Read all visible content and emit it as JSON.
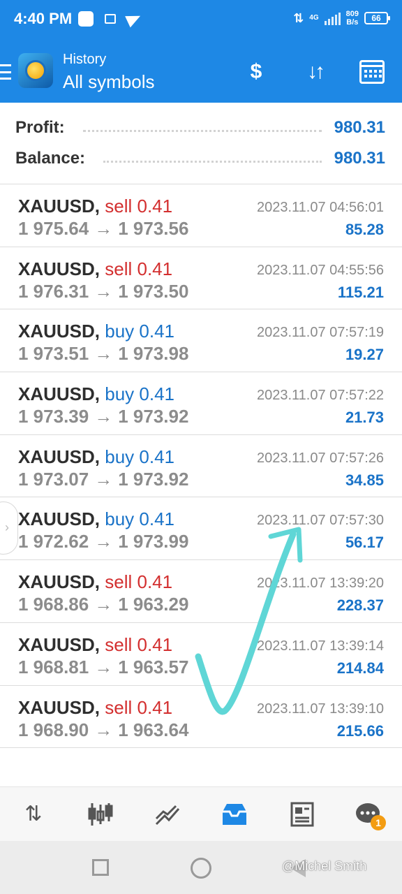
{
  "status": {
    "time": "4:40 PM",
    "network": "4G",
    "speed_value": "809",
    "speed_unit": "B/s",
    "battery": "66"
  },
  "header": {
    "subtitle": "History",
    "title": "All symbols",
    "icons": [
      "currency-exchange-icon",
      "sort-icon",
      "calendar-icon"
    ]
  },
  "summary": {
    "profit_label": "Profit:",
    "profit_value": "980.31",
    "balance_label": "Balance:",
    "balance_value": "980.31"
  },
  "deals": [
    {
      "symbol": "XAUUSD,",
      "direction": "sell",
      "volume": "0.41",
      "open": "1 975.64",
      "close": "1 973.56",
      "time": "2023.11.07 04:56:01",
      "profit": "85.28"
    },
    {
      "symbol": "XAUUSD,",
      "direction": "sell",
      "volume": "0.41",
      "open": "1 976.31",
      "close": "1 973.50",
      "time": "2023.11.07 04:55:56",
      "profit": "115.21"
    },
    {
      "symbol": "XAUUSD,",
      "direction": "buy",
      "volume": "0.41",
      "open": "1 973.51",
      "close": "1 973.98",
      "time": "2023.11.07 07:57:19",
      "profit": "19.27"
    },
    {
      "symbol": "XAUUSD,",
      "direction": "buy",
      "volume": "0.41",
      "open": "1 973.39",
      "close": "1 973.92",
      "time": "2023.11.07 07:57:22",
      "profit": "21.73"
    },
    {
      "symbol": "XAUUSD,",
      "direction": "buy",
      "volume": "0.41",
      "open": "1 973.07",
      "close": "1 973.92",
      "time": "2023.11.07 07:57:26",
      "profit": "34.85"
    },
    {
      "symbol": "XAUUSD,",
      "direction": "buy",
      "volume": "0.41",
      "open": "1 972.62",
      "close": "1 973.99",
      "time": "2023.11.07 07:57:30",
      "profit": "56.17"
    },
    {
      "symbol": "XAUUSD,",
      "direction": "sell",
      "volume": "0.41",
      "open": "1 968.86",
      "close": "1 963.29",
      "time": "2023.11.07 13:39:20",
      "profit": "228.37"
    },
    {
      "symbol": "XAUUSD,",
      "direction": "sell",
      "volume": "0.41",
      "open": "1 968.81",
      "close": "1 963.57",
      "time": "2023.11.07 13:39:14",
      "profit": "214.84"
    },
    {
      "symbol": "XAUUSD,",
      "direction": "sell",
      "volume": "0.41",
      "open": "1 968.90",
      "close": "1 963.64",
      "time": "2023.11.07 13:39:10",
      "profit": "215.66"
    }
  ],
  "bottom_nav": {
    "items": [
      "quotes-icon",
      "chart-icon",
      "trade-icon",
      "history-icon",
      "news-icon",
      "chat-icon"
    ],
    "active": "history-icon",
    "chat_badge": "1"
  },
  "watermark": "@Michel Smith",
  "colors": {
    "accent": "#1e88e5",
    "sell": "#d32f2f",
    "buy": "#1a73c8",
    "profit": "#1a73c8",
    "annotation": "#5fd6d6"
  }
}
